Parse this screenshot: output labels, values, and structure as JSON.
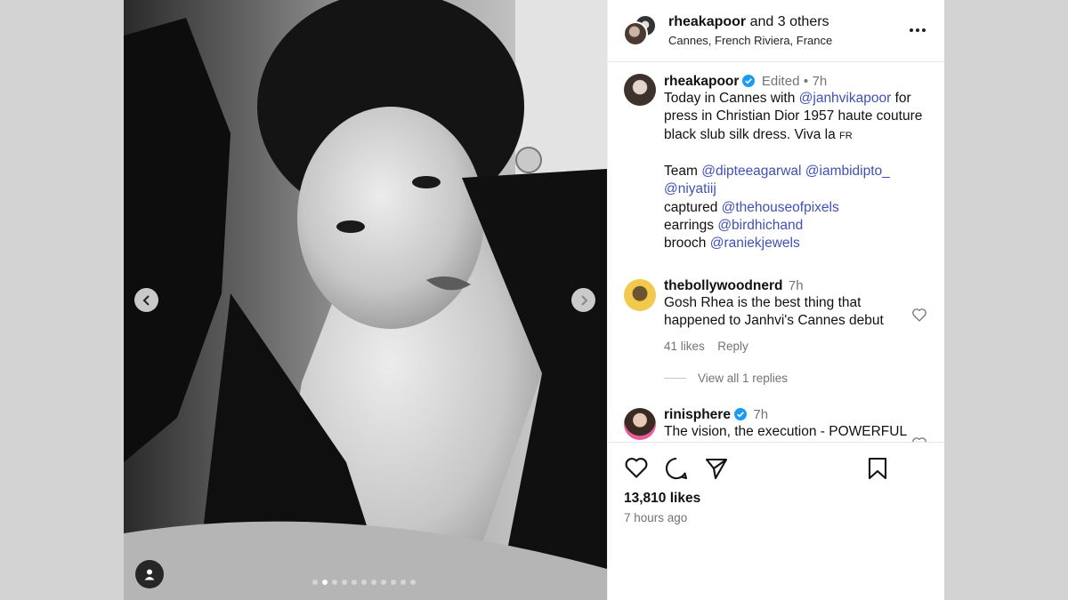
{
  "header": {
    "author": "rheakapoor",
    "and_others": "and 3 others",
    "location": "Cannes, French Riviera, France"
  },
  "carousel": {
    "slide_count": 11,
    "active_index": 1
  },
  "caption": {
    "username": "rheakapoor",
    "edited": "Edited",
    "separator": "•",
    "time": "7h",
    "line1_a": "Today in Cannes with ",
    "line1_mention": "@janhvikapoor",
    "line1_b": " for",
    "line2": "press in Christian Dior 1957 haute couture",
    "line3": "black slub silk dress. Viva la ",
    "flag": "FR",
    "team_label": "Team ",
    "team_m1": "@dipteeagarwal",
    "team_m2": "@iambidipto_",
    "team_m3": "@niyatiij",
    "captured_label": "captured ",
    "captured_m": "@thehouseofpixels",
    "earrings_label": "earrings ",
    "earrings_m": "@birdhichand",
    "brooch_label": "brooch ",
    "brooch_m": "@raniekjewels"
  },
  "comments": [
    {
      "username": "thebollywoodnerd",
      "time": "7h",
      "line1": "Gosh Rhea is the best thing that",
      "line2": "happened to Janhvi's Cannes debut",
      "likes": "41 likes",
      "reply": "Reply",
      "view_replies": "View all 1 replies"
    },
    {
      "username": "rinisphere",
      "time": "7h",
      "line1": "The vision, the execution - POWERFUL"
    }
  ],
  "footer": {
    "likes": "13,810 likes",
    "posted": "7 hours ago"
  },
  "colors": {
    "mention": "#3f51b5",
    "verified": "#1d9bf0",
    "muted": "#737373"
  }
}
